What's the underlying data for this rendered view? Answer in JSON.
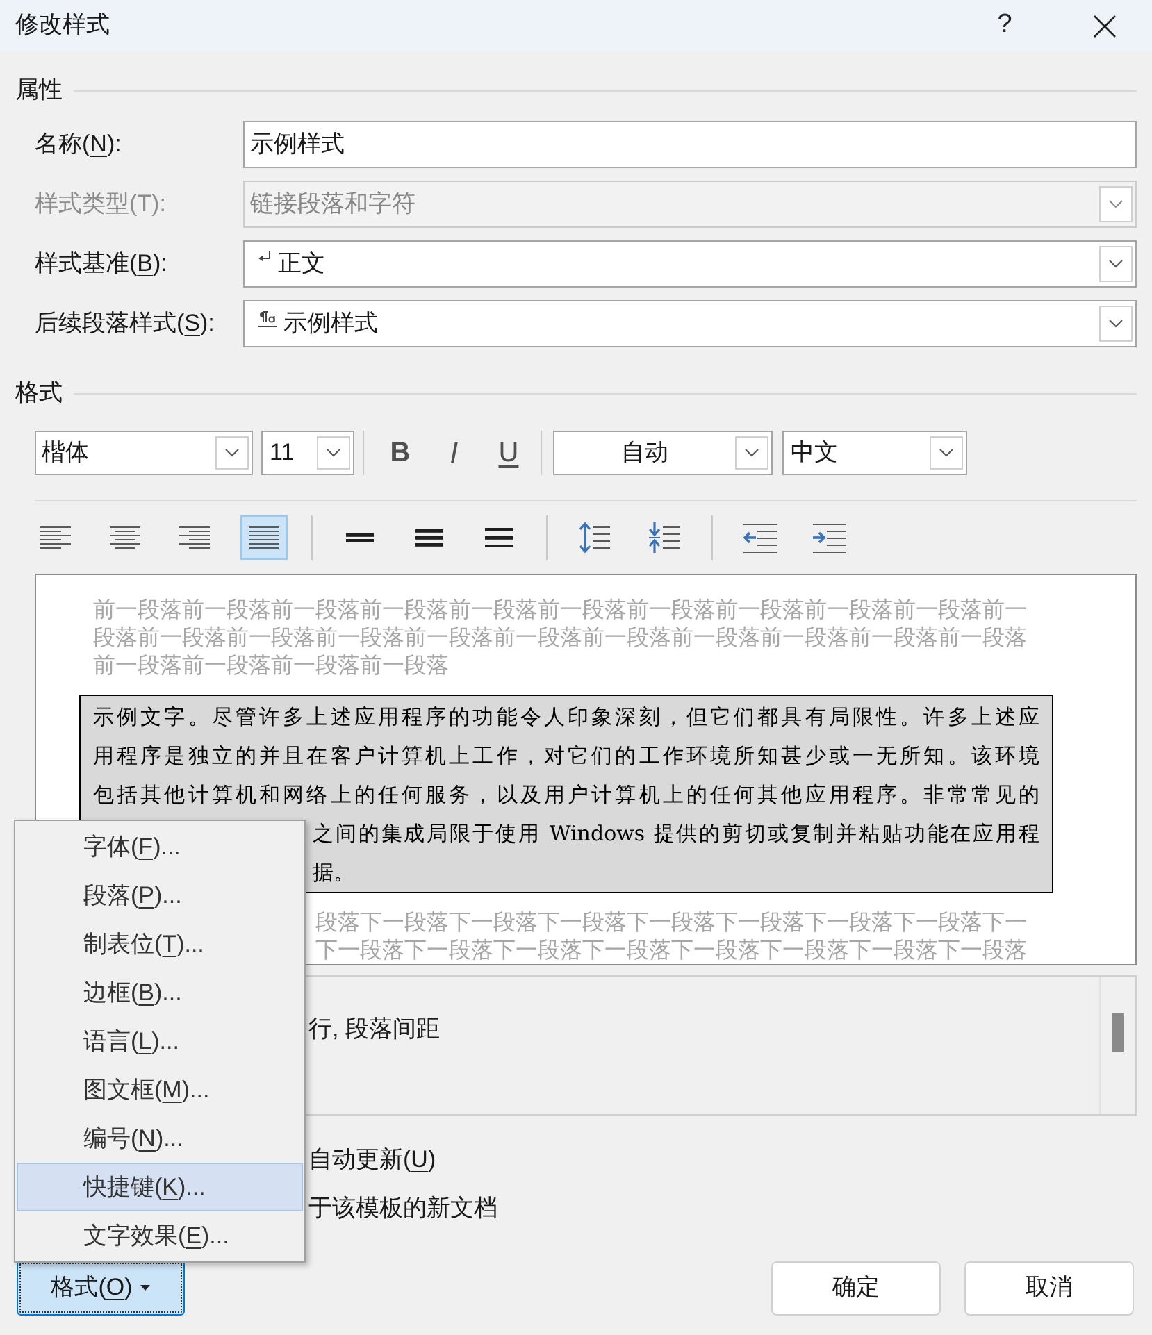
{
  "window": {
    "title": "修改样式",
    "help": "?"
  },
  "properties": {
    "heading": "属性",
    "fields": [
      {
        "kind": "text",
        "label_start": "名称(",
        "access_key": "N",
        "label_end": "):",
        "value": "示例样式",
        "disabled": false
      },
      {
        "kind": "dropdown",
        "label": "样式类型(T):",
        "value": {
          "text": "链接段落和字符"
        },
        "disabled": true
      },
      {
        "kind": "dropdown",
        "label_start": "样式基准(",
        "access_key": "B",
        "label_end": "):",
        "value": {
          "kind": "paragraph",
          "text": "正文"
        },
        "disabled": false
      },
      {
        "kind": "dropdown",
        "label_start": "后续段落样式(",
        "access_key": "S",
        "label_end": "):",
        "value": {
          "kind": "linked",
          "text": "示例样式"
        },
        "disabled": false
      }
    ]
  },
  "format": {
    "heading": "格式",
    "font": {
      "value": "楷体"
    },
    "size": {
      "value": "11"
    },
    "text_style": [
      {
        "kind": "bold",
        "label": "B",
        "selected": false
      },
      {
        "kind": "italic",
        "label": "I",
        "selected": false
      },
      {
        "kind": "underline",
        "label": "U",
        "selected": false
      }
    ],
    "font_color": {
      "value": "自动"
    },
    "language": {
      "value": "中文"
    },
    "alignment": [
      {
        "kind": "left",
        "selected": false
      },
      {
        "kind": "center",
        "selected": false
      },
      {
        "kind": "right",
        "selected": false
      },
      {
        "kind": "justify",
        "selected": true
      }
    ],
    "line_spacing": [
      {
        "kind": "single",
        "selected": false
      },
      {
        "kind": "one-and-half",
        "selected": false
      },
      {
        "kind": "double",
        "selected": false
      }
    ],
    "paragraph_spacing": [
      {
        "kind": "increase"
      },
      {
        "kind": "decrease"
      }
    ],
    "indent": [
      {
        "kind": "decrease"
      },
      {
        "kind": "increase"
      }
    ]
  },
  "preview": {
    "previous_paragraph": [
      {
        "text": "前一段落前一段落前一段落前一段落前一段落前一段落前一段落前一段落前一段落前一段落前一",
        "partly_hidden": false
      },
      {
        "text": "段落前一段落前一段落前一段落前一段落前一段落前一段落前一段落前一段落前一段落前一段落",
        "partly_hidden": false
      },
      {
        "text": "前一段落前一段落前一段落前一段落",
        "partly_hidden": false
      }
    ],
    "sample": [
      {
        "text": "示例文字。尽管许多上述应用程序的功能令人印象深刻，但它们都具有局限性。许多上述应",
        "partly_hidden": false
      },
      {
        "text": "用程序是独立的并且在客户计算机上工作，对它们的工作环境所知甚少或一无所知。该环境",
        "partly_hidden": false
      },
      {
        "text": "包括其他计算机和网络上的任何服务，以及用户计算机上的任何其他应用程序。非常常见的",
        "partly_hidden": false
      },
      {
        "text": "之间的集成局限于使用 Windows 提供的剪切或复制并粘贴功能在应用程",
        "partly_hidden": true
      },
      {
        "text": "据。",
        "partly_hidden": true
      }
    ],
    "next_paragraph": [
      {
        "text": "段落下一段落下一段落下一段落下一段落下一段落下一段落下一段落下一",
        "partly_hidden": true
      },
      {
        "text": "下一段落下一段落下一段落下一段落下一段落下一段落下一段落下一段落",
        "partly_hidden": true
      }
    ]
  },
  "description": {
    "text": "行, 段落间距",
    "partly_hidden": true
  },
  "options": [
    {
      "label_start": "自动更新(",
      "access_key": "U",
      "label_end": ")",
      "partly_hidden": true
    },
    {
      "label": "于该模板的新文档",
      "partly_hidden": true
    }
  ],
  "format_menu": {
    "open": true,
    "items": [
      {
        "label_start": "字体(",
        "access_key": "F",
        "label_end": ")...",
        "selected": false
      },
      {
        "label_start": "段落(",
        "access_key": "P",
        "label_end": ")...",
        "selected": false
      },
      {
        "label_start": "制表位(",
        "access_key": "T",
        "label_end": ")...",
        "selected": false
      },
      {
        "label_start": "边框(",
        "access_key": "B",
        "label_end": ")...",
        "selected": false
      },
      {
        "label_start": "语言(",
        "access_key": "L",
        "label_end": ")...",
        "selected": false
      },
      {
        "label_start": "图文框(",
        "access_key": "M",
        "label_end": ")...",
        "selected": false
      },
      {
        "label_start": "编号(",
        "access_key": "N",
        "label_end": ")...",
        "selected": false
      },
      {
        "label_start": "快捷键(",
        "access_key": "K",
        "label_end": ")...",
        "selected": true
      },
      {
        "label_start": "文字效果(",
        "access_key": "E",
        "label_end": ")...",
        "selected": false
      }
    ]
  },
  "format_button": {
    "label_start": "格式(",
    "access_key": "O",
    "label_end": ")",
    "pressed": true
  },
  "buttons": [
    {
      "label": "确定"
    },
    {
      "label": "取消"
    }
  ]
}
